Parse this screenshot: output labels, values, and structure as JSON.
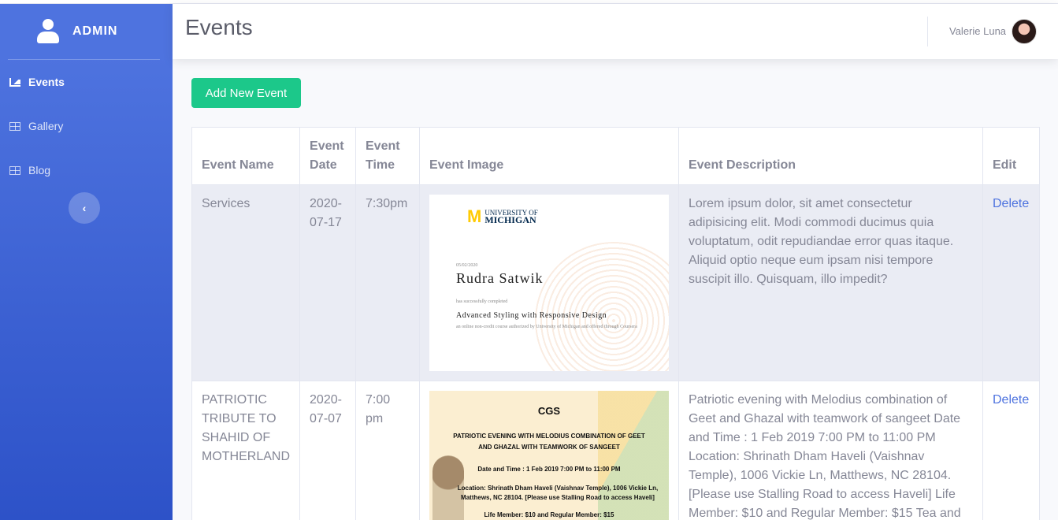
{
  "sidebar": {
    "brand": "ADMIN",
    "items": [
      {
        "label": "Events",
        "icon": "chart-area-icon",
        "active": true
      },
      {
        "label": "Gallery",
        "icon": "table-icon",
        "active": false
      },
      {
        "label": "Blog",
        "icon": "table-icon",
        "active": false
      }
    ],
    "toggle_glyph": "‹"
  },
  "topbar": {
    "title": "Events",
    "user_name": "Valerie Luna"
  },
  "main": {
    "add_button": "Add New Event",
    "table": {
      "headers": [
        "Event Name",
        "Event Date",
        "Event Time",
        "Event Image",
        "Event Description",
        "Edit"
      ],
      "rows": [
        {
          "name": "Services",
          "date": "2020-07-17",
          "time": "7:30pm",
          "image": {
            "logo_line1": "UNIVERSITY OF",
            "logo_line2": "MICHIGAN",
            "cert_date": "05/02/2020",
            "recipient": "Rudra Satwik",
            "completed_text": "has successfully completed",
            "course": "Advanced Styling with Responsive Design",
            "footer": "an online non-credit course authorized by University of Michigan and offered through Coursera"
          },
          "description": "Lorem ipsum dolor, sit amet consectetur adipisicing elit. Modi commodi ducimus quia voluptatum, odit repudiandae error quas itaque. Aliquid optio neque eum ipsam nisi tempore suscipit illo. Quisquam, illo impedit?",
          "edit": "Delete"
        },
        {
          "name": "PATRIOTIC TRIBUTE TO SHAHID OF MOTHERLAND",
          "date": "2020-07-07",
          "time": "7:00 pm",
          "image": {
            "line1": "CGS",
            "line2": "PATRIOTIC EVENING WITH MELODIUS COMBINATION OF GEET",
            "line3": "AND GHAZAL WITH TEAMWORK OF SANGEET",
            "line4": "Date and Time :  1 Feb 2019 7:00 PM to 11:00 PM",
            "line5": "Location: Shrinath Dham Haveli (Vaishnav Temple), 1006 Vickie Ln,",
            "line6": "Matthews, NC 28104. [Please use Stalling Road to access Haveli]",
            "line7": "Life Member: $10  and Regular Member: $15"
          },
          "description": "Patriotic evening with Melodius combination of Geet and Ghazal with teamwork of sangeet Date and Time : 1 Feb 2019 7:00 PM to 11:00 PM Location: Shrinath Dham Haveli (Vaishnav Temple), 1006 Vickie Ln, Matthews, NC 28104. [Please use Stalling Road to access Haveli] Life Member: $10 and Regular Member: $15 Tea and",
          "edit": "Delete"
        }
      ]
    }
  },
  "colors": {
    "sidebar": "#4e73df",
    "success": "#1cc88a",
    "link": "#4e73df",
    "text": "#858796"
  }
}
